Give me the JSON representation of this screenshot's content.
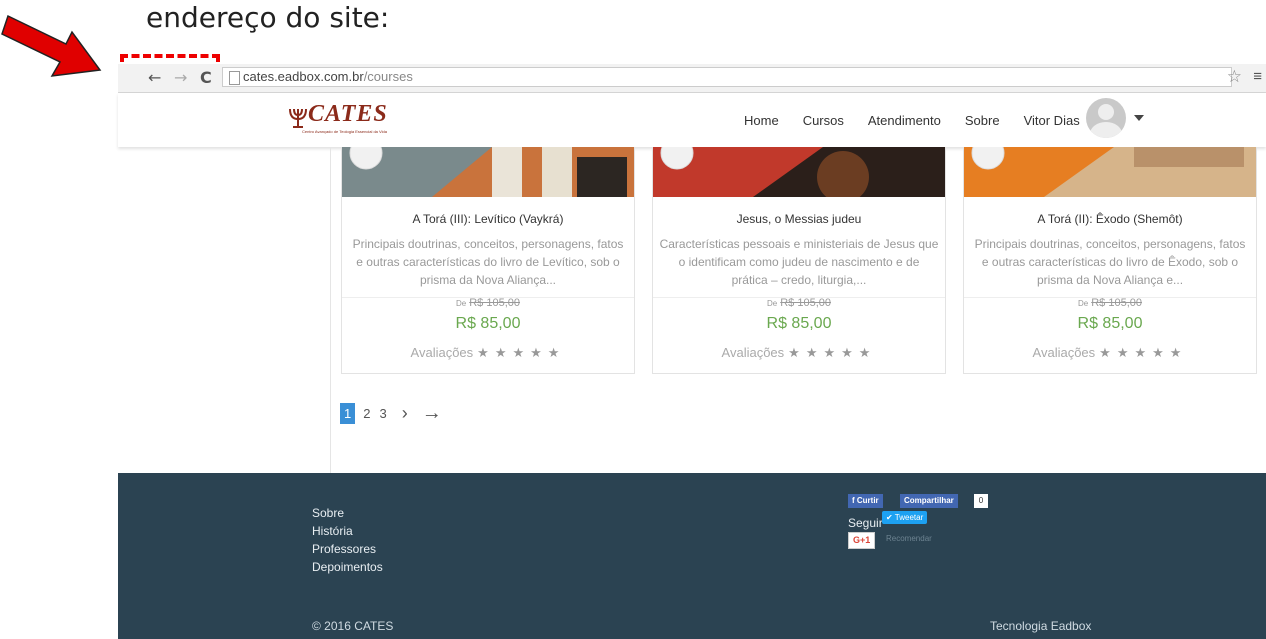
{
  "caption": "endereço do site:",
  "browser": {
    "url_host": "cates.eadbox.com.br",
    "url_path": "/courses",
    "back_glyph": "←",
    "forward_glyph": "→",
    "reload_glyph": "C",
    "star_glyph": "☆",
    "menu_glyph": "≡"
  },
  "header": {
    "logo_text": "CATES",
    "logo_sub": "Centro Avançado de Teologia Essencial da Vida",
    "nav": [
      "Home",
      "Cursos",
      "Atendimento",
      "Sobre"
    ],
    "user_name": "Vitor Dias"
  },
  "courses": [
    {
      "title": "A Torá (III): Levítico (Vaykrá)",
      "description": "Principais doutrinas, conceitos, personagens, fatos e outras características do livro de Levítico, sob o prisma da Nova Aliança...",
      "old_prefix": "De",
      "old_price": "R$ 105,00",
      "price": "R$ 85,00",
      "rating_label": "Avaliações",
      "stars": "★★★★★"
    },
    {
      "title": "Jesus, o Messias judeu",
      "description": "Características pessoais e ministeriais de Jesus que o identificam como judeu de nascimento e de prática – credo, liturgia,...",
      "old_prefix": "De",
      "old_price": "R$ 105,00",
      "price": "R$ 85,00",
      "rating_label": "Avaliações",
      "stars": "★★★★★"
    },
    {
      "title": "A Torá (II): Êxodo (Shemôt)",
      "description": "Principais doutrinas, conceitos, personagens, fatos e outras características do livro de Êxodo, sob o prisma da Nova Aliança e...",
      "old_prefix": "De",
      "old_price": "R$ 105,00",
      "price": "R$ 85,00",
      "rating_label": "Avaliações",
      "stars": "★★★★★"
    }
  ],
  "pagination": {
    "current": "1",
    "pages": [
      "2",
      "3"
    ],
    "next": "›",
    "last": "→"
  },
  "footer": {
    "links": [
      "Sobre",
      "História",
      "Professores",
      "Depoimentos"
    ],
    "copyright": "© 2016 CATES",
    "tech": "Tecnologia Eadbox",
    "fb_like": "Curtir",
    "fb_share": "Compartilhar",
    "fb_count": "0",
    "seguir": "Seguir",
    "tweet": "Tweetar",
    "gplus": "G+1",
    "recomendar": "Recomendar"
  }
}
